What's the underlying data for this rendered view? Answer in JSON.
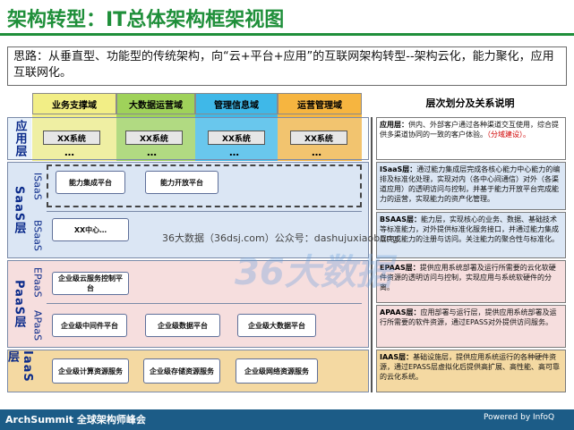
{
  "title": "架构转型：IT总体架构框架视图",
  "intro": "思路：从垂直型、功能型的传统架构，向“云+平台+应用”的互联网架构转型--架构云化，能力聚化，应用互联网化。",
  "right_title": "层次划分及关系说明",
  "domains": [
    "业务支撑域",
    "大数据运营域",
    "管理信息域",
    "运营管理域"
  ],
  "layers": {
    "app": {
      "label": "应用层",
      "items": [
        "XX系统",
        "XX系统",
        "XX系统",
        "XX系统"
      ],
      "dots": "…"
    },
    "saas": {
      "label": "SaaS层",
      "isaas": "ISaaS",
      "bsaas": "BSaaS",
      "isaas_items": [
        "能力集成平台",
        "能力开放平台"
      ],
      "bsaas_items": [
        "XX中心…"
      ]
    },
    "paas": {
      "label": "PaaS层",
      "epaas": "EPaaS",
      "apaas": "APaaS",
      "epaas_items": [
        "企业级云服务控制平台"
      ],
      "apaas_items": [
        "企业级中间件平台",
        "企业级数据平台",
        "企业级大数据平台"
      ]
    },
    "iaas": {
      "label": "IaaS层",
      "items": [
        "企业级计算资源服务",
        "企业级存储资源服务",
        "企业级网络资源服务"
      ]
    }
  },
  "descriptions": {
    "app": {
      "head": "应用层：",
      "body": "供内、外部客户通过各种渠道交互使用，综合提供多渠道协同的一致的客户体验。",
      "note": "（分域建设）。"
    },
    "isaas": {
      "head": "ISaaS层：",
      "body": "通过能力集成层完成各核心能力中心能力的编排及标准化处理，实现对内（各中心间通信）对外（各渠道应用）的透明访问与控制，并基于能力开放平台完成能力的运营，实现能力的资产化管理。"
    },
    "bsaas": {
      "head": "BSAAS层：",
      "body": "能力层，实现核心的业务、数据、基础技术等标准能力，对外提供标准化服务接口，并通过能力集成层完成能力的注册与访问。关注能力的聚合性与标准化。"
    },
    "epaas": {
      "head": "EPAAS层：",
      "body": "提供应用系统部署及运行所需要的云化软硬件资源的透明访问与控制，实现应用与系统软硬件的分离。"
    },
    "apaas": {
      "head": "APAAS层：",
      "body": "应用部署与运行层，提供应用系统部署及运行所需要的软件资源，通过EPASS对外提供访问服务。"
    },
    "iaas": {
      "head": "IAAS层：",
      "body": "基础设施层，提供应用系统运行的各种硬件资源，通过EPASS层虚拟化后提供高扩展、高性能、高可靠的云化系统。"
    }
  },
  "watermark": "36大数据（36dsj.com）公众号：dashujuxiaobang",
  "watermark_logo": "36大数据",
  "footer": {
    "brand": "ArchSummit  全球架构师峰会",
    "powered": "Powered by InfoQ"
  },
  "colors": {
    "green_title": "#1f8f3a",
    "domain1": "#f2ee86",
    "domain2": "#9fd25a",
    "domain3": "#3fb8e8",
    "domain4": "#f6b540",
    "app_band": "#e9f2fb",
    "saas_band": "#dbe6f4",
    "paas_band": "#f6dede",
    "iaas_band": "#f4d9a2",
    "footer": "#1c5c87"
  }
}
